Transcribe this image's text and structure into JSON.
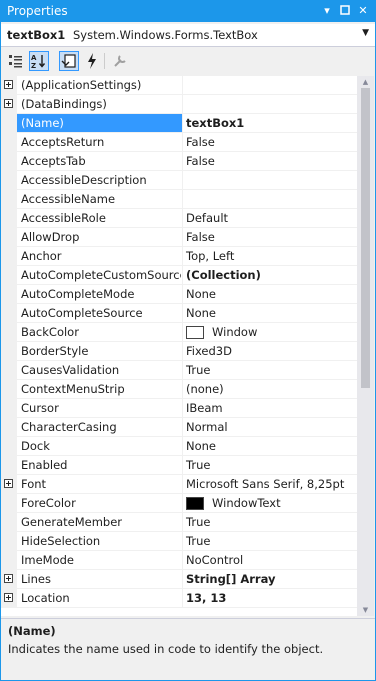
{
  "window": {
    "title": "Properties"
  },
  "selector": {
    "object_name": "textBox1",
    "object_type": "System.Windows.Forms.TextBox"
  },
  "colors": {
    "accent": "#1c97ea",
    "selection": "#3399ff",
    "window_swatch": "#ffffff",
    "windowtext_swatch": "#000000"
  },
  "toolbar": {
    "icons": [
      "categorized-icon",
      "alphabetical-icon",
      "properties-icon",
      "events-icon",
      "property-pages-icon"
    ]
  },
  "properties": [
    {
      "name": "(ApplicationSettings)",
      "value": "",
      "expandable": true
    },
    {
      "name": "(DataBindings)",
      "value": "",
      "expandable": true
    },
    {
      "name": "(Name)",
      "value": "textBox1",
      "selected": true
    },
    {
      "name": "AcceptsReturn",
      "value": "False"
    },
    {
      "name": "AcceptsTab",
      "value": "False"
    },
    {
      "name": "AccessibleDescription",
      "value": ""
    },
    {
      "name": "AccessibleName",
      "value": ""
    },
    {
      "name": "AccessibleRole",
      "value": "Default"
    },
    {
      "name": "AllowDrop",
      "value": "False"
    },
    {
      "name": "Anchor",
      "value": "Top, Left"
    },
    {
      "name": "AutoCompleteCustomSource",
      "value": "(Collection)",
      "bold": true
    },
    {
      "name": "AutoCompleteMode",
      "value": "None"
    },
    {
      "name": "AutoCompleteSource",
      "value": "None"
    },
    {
      "name": "BackColor",
      "value": "Window",
      "swatch": "#ffffff"
    },
    {
      "name": "BorderStyle",
      "value": "Fixed3D"
    },
    {
      "name": "CausesValidation",
      "value": "True"
    },
    {
      "name": "ContextMenuStrip",
      "value": "(none)"
    },
    {
      "name": "Cursor",
      "value": "IBeam"
    },
    {
      "name": "CharacterCasing",
      "value": "Normal"
    },
    {
      "name": "Dock",
      "value": "None"
    },
    {
      "name": "Enabled",
      "value": "True"
    },
    {
      "name": "Font",
      "value": "Microsoft Sans Serif, 8,25pt",
      "expandable": true
    },
    {
      "name": "ForeColor",
      "value": "WindowText",
      "swatch": "#000000"
    },
    {
      "name": "GenerateMember",
      "value": "True"
    },
    {
      "name": "HideSelection",
      "value": "True"
    },
    {
      "name": "ImeMode",
      "value": "NoControl"
    },
    {
      "name": "Lines",
      "value": "String[] Array",
      "expandable": true,
      "bold": true
    },
    {
      "name": "Location",
      "value": "13, 13",
      "expandable": true,
      "bold": true
    }
  ],
  "description": {
    "title": "(Name)",
    "text": "Indicates the name used in code to identify the object."
  }
}
